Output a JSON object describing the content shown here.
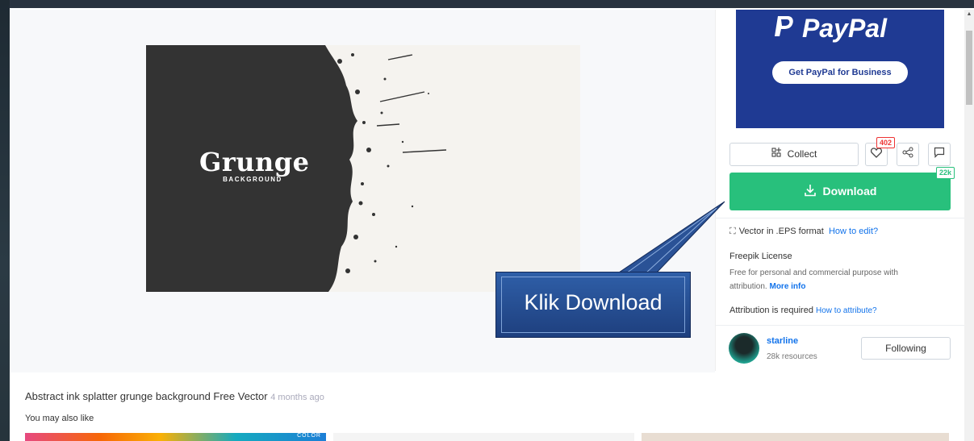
{
  "ad": {
    "logo_text": "PayPal",
    "button_label": "Get PayPal for Business"
  },
  "preview": {
    "title": "Grunge",
    "subtitle": "BACKGROUND"
  },
  "actions": {
    "collect_label": "Collect",
    "likes_count": "402",
    "download_label": "Download",
    "downloads_count": "22k"
  },
  "info": {
    "format_text": "Vector in .EPS format",
    "how_to_edit": "How to edit?",
    "license_title": "Freepik License",
    "license_text": "Free for personal and commercial purpose with attribution.",
    "more_info": "More info",
    "attribution_text": "Attribution is required",
    "how_to_attribute": "How to attribute?"
  },
  "author": {
    "name": "starline",
    "resources": "28k resources",
    "follow_label": "Following"
  },
  "callout": {
    "text": "Klik Download"
  },
  "main": {
    "resource_title": "Abstract ink splatter grunge background Free Vector",
    "time_ago": "4 months ago",
    "related_heading": "You may also like",
    "thumb1_label": "COLOR"
  },
  "colors": {
    "download_green": "#28c07c",
    "link_blue": "#1273eb",
    "paypal_blue": "#1f3a93",
    "badge_red": "#ee3333"
  },
  "icons": [
    "paypal-icon",
    "collect-icon",
    "heart-icon",
    "share-icon",
    "comment-icon",
    "download-icon",
    "vector-format-icon",
    "scroll-up-icon"
  ]
}
